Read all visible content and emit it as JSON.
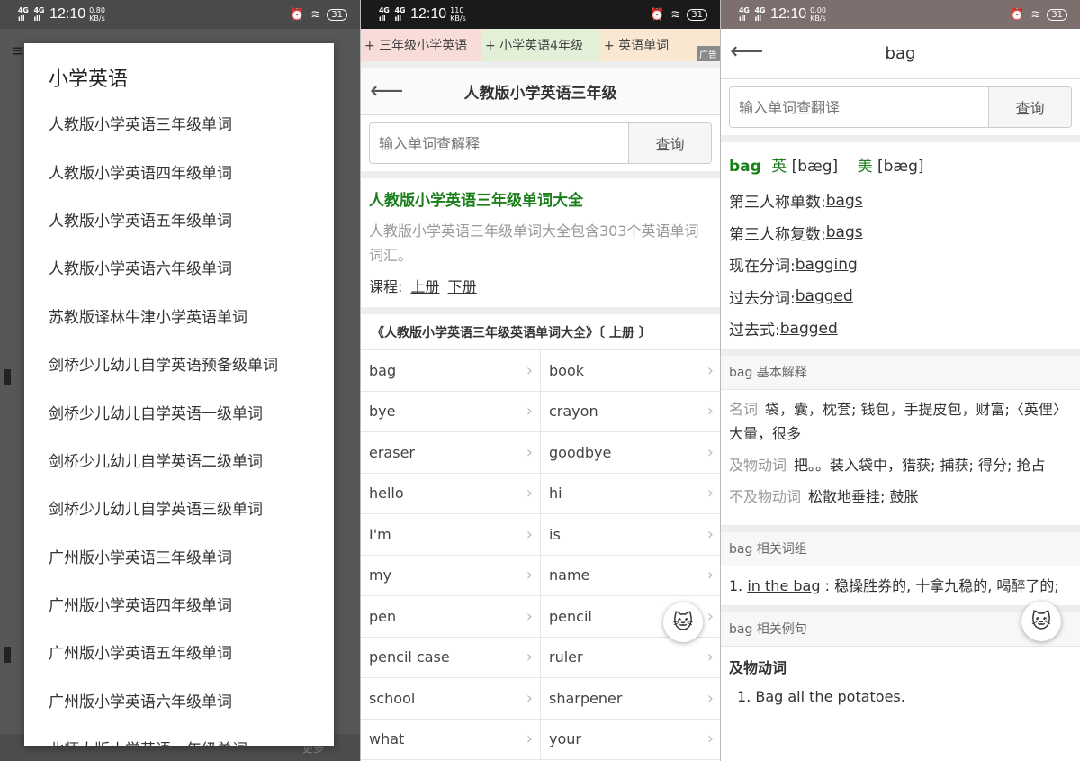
{
  "status": {
    "net_label": "4GHD",
    "time": "12:10",
    "battery": "31",
    "speed1": "0.80 KB/s",
    "speed2": "110 KB/s",
    "speed3": "0.00 KB/s"
  },
  "screen1": {
    "dialog_title": "小学英语",
    "items": [
      "人教版小学英语三年级单词",
      "人教版小学英语四年级单词",
      "人教版小学英语五年级单词",
      "人教版小学英语六年级单词",
      "苏教版译林牛津小学英语单词",
      "剑桥少儿幼儿自学英语预备级单词",
      "剑桥少儿幼儿自学英语一级单词",
      "剑桥少儿幼儿自学英语二级单词",
      "剑桥少儿幼儿自学英语三级单词",
      "广州版小学英语三年级单词",
      "广州版小学英语四年级单词",
      "广州版小学英语五年级单词",
      "广州版小学英语六年级单词",
      "北师大版小学英语一年级单词"
    ],
    "bg_more": "更多"
  },
  "screen2": {
    "ads": [
      "+ 三年级小学英语",
      "+ 小学英语4年级",
      "+ 英语单词"
    ],
    "ad_tag": "广告",
    "title": "人教版小学英语三年级",
    "search_placeholder": "输入单词查解释",
    "search_button": "查询",
    "intro_heading": "人教版小学英语三年级单词大全",
    "intro_desc": "人教版小学英语三年级单词大全包含303个英语单词词汇。",
    "course_label": "课程:",
    "course_links": [
      "上册",
      "下册"
    ],
    "section_title": "《人教版小学英语三年级英语单词大全》〔 上册 〕",
    "words": [
      "bag",
      "book",
      "bye",
      "crayon",
      "eraser",
      "goodbye",
      "hello",
      "hi",
      "I'm",
      "is",
      "my",
      "name",
      "pen",
      "pencil",
      "pencil case",
      "ruler",
      "school",
      "sharpener",
      "what",
      "your"
    ]
  },
  "screen3": {
    "title": "bag",
    "search_placeholder": "输入单词查翻译",
    "search_button": "查询",
    "headword": "bag",
    "uk_label": "英",
    "uk_phon": "[bæg]",
    "us_label": "美",
    "us_phon": "[bæg]",
    "forms": [
      {
        "label": "第三人称单数:",
        "value": "bags"
      },
      {
        "label": "第三人称复数:",
        "value": "bags"
      },
      {
        "label": "现在分词:",
        "value": "bagging"
      },
      {
        "label": "过去分词:",
        "value": "bagged"
      },
      {
        "label": "过去式:",
        "value": "bagged"
      }
    ],
    "basic_title": "bag 基本解释",
    "defs": [
      {
        "pos": "名词",
        "text": "袋，囊，枕套; 钱包，手提皮包，财富;〈英俚〉大量，很多"
      },
      {
        "pos": "及物动词",
        "text": "把。。装入袋中，猎获; 捕获; 得分; 抢占"
      },
      {
        "pos": "不及物动词",
        "text": "松散地垂挂; 鼓胀"
      }
    ],
    "phrases_title": "bag 相关词组",
    "phrase_num": "1.",
    "phrase_link": "in the bag",
    "phrase_text": ": 稳操胜券的, 十拿九稳的, 喝醉了的;",
    "examples_title": "bag 相关例句",
    "ex_pos": "及物动词",
    "ex_sentence": "1. Bag all the potatoes."
  }
}
